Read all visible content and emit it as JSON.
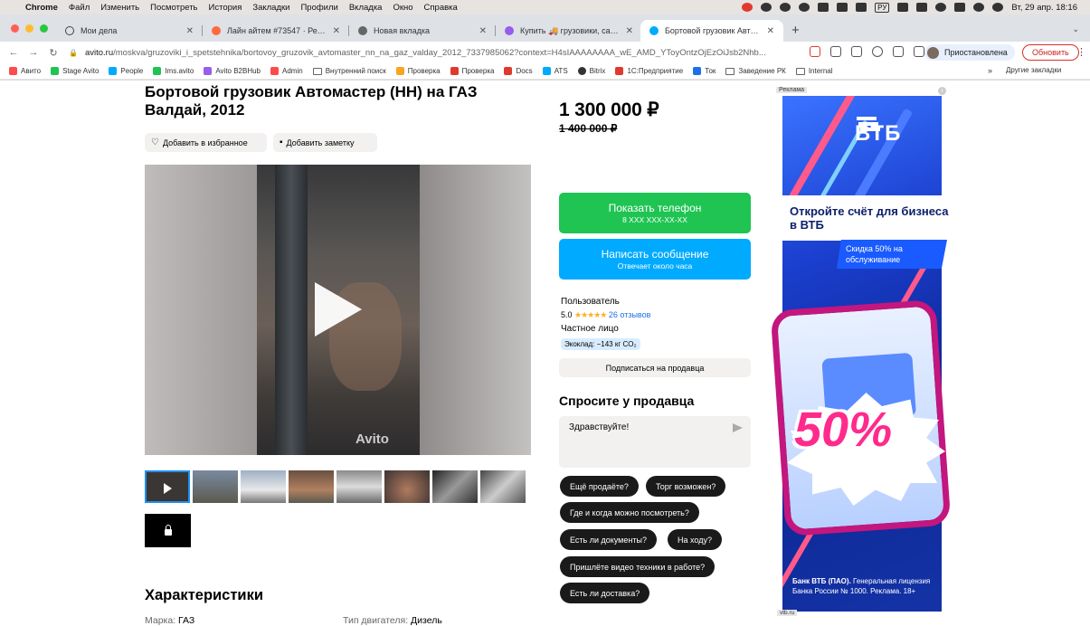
{
  "menubar": {
    "app": "Chrome",
    "items": [
      "Файл",
      "Изменить",
      "Посмотреть",
      "История",
      "Закладки",
      "Профили",
      "Вкладка",
      "Окно",
      "Справка"
    ],
    "lang": "РУ",
    "clock": "Вт, 29 апр.  18:16"
  },
  "tabs": [
    {
      "label": "Мои дела"
    },
    {
      "label": "Лайн айтем #73547 · Редакти"
    },
    {
      "label": "Новая вкладка"
    },
    {
      "label": "Купить 🚚 грузовики, самосв"
    },
    {
      "label": "Бортовой грузовик Автомастер"
    }
  ],
  "address": {
    "host": "avito.ru",
    "path": "/moskva/gruzoviki_i_spetstehnika/bortovoy_gruzovik_avtomaster_nn_na_gaz_valday_2012_7337985062?context=H4sIAAAAAAAA_wE_AMD_YToyOntzOjEzOiJsb2Nhb..."
  },
  "profile": {
    "label": "Приостановлена"
  },
  "update_button": "Обновить",
  "bookmarks": [
    {
      "label": "Авито",
      "color": "#ff4b4b"
    },
    {
      "label": "Stage Avito",
      "color": "#1fc453"
    },
    {
      "label": "People",
      "color": "#00aaff"
    },
    {
      "label": "Ims.avito",
      "color": "#1fc453"
    },
    {
      "label": "Avito B2BHub",
      "color": "#965eeb"
    },
    {
      "label": "Admin",
      "color": "#ff4b4b"
    },
    {
      "label": "Внутренний поиск",
      "color": "#888"
    },
    {
      "label": "Проверка",
      "color": "#f5a623"
    },
    {
      "label": "Проверка",
      "color": "#e03a2e"
    },
    {
      "label": "Docs",
      "color": "#e03a2e"
    },
    {
      "label": "ATS",
      "color": "#00aaff"
    },
    {
      "label": "Bitrix",
      "color": "#333"
    },
    {
      "label": "1С:Предприятие",
      "color": "#e03a2e"
    },
    {
      "label": "Ток",
      "color": "#1e70e8"
    },
    {
      "label": "Заведение РК",
      "color": "#888"
    },
    {
      "label": "Internal",
      "color": "#888"
    }
  ],
  "bookmarks_more": "»",
  "bookmarks_other": "Другие закладки",
  "listing": {
    "title": "Бортовой грузовик Автомастер (НН) на ГАЗ Валдай, 2012",
    "favorite_label": "Добавить в избранное",
    "note_label": "Добавить заметку",
    "watermark": "Avito",
    "price": "1 300 000 ₽",
    "old_price": "1 400 000 ₽",
    "phone_button": {
      "label": "Показать телефон",
      "sub": "8 XXX XXX-XX-XX"
    },
    "message_button": {
      "label": "Написать сообщение",
      "sub": "Отвечает около часа"
    },
    "seller": {
      "name": "Пользователь",
      "rating": "5.0",
      "stars": "★★★★★",
      "reviews": "26 отзывов",
      "type": "Частное лицо",
      "eco": "Экоклад: −143 кг CO₂"
    },
    "subscribe_label": "Подписаться на продавца",
    "ask": {
      "heading": "Спросите у продавца",
      "message": "Здравствуйте!",
      "chips": [
        "Ещё продаёте?",
        "Торг возможен?",
        "Где и когда можно посмотреть?",
        "Есть ли документы?",
        "На ходу?",
        "Пришлёте видео техники в работе?",
        "Есть ли доставка?"
      ]
    },
    "characteristics": {
      "heading": "Характеристики",
      "make_label": "Марка:",
      "make_value": "ГАЗ",
      "engine_label": "Тип двигателя:",
      "engine_value": "Дизель"
    }
  },
  "ad": {
    "label": "Реклама",
    "brand": "ВТБ",
    "headline": "Откройте счёт для бизнеса в ВТБ",
    "offer": "Скидка 50% на обслуживание",
    "big": "50%",
    "footer_bold": "Банк ВТБ (ПАО).",
    "footer": " Генеральная лицензия Банка России № 1000. Реклама. 18+",
    "url": "vtb.ru"
  }
}
